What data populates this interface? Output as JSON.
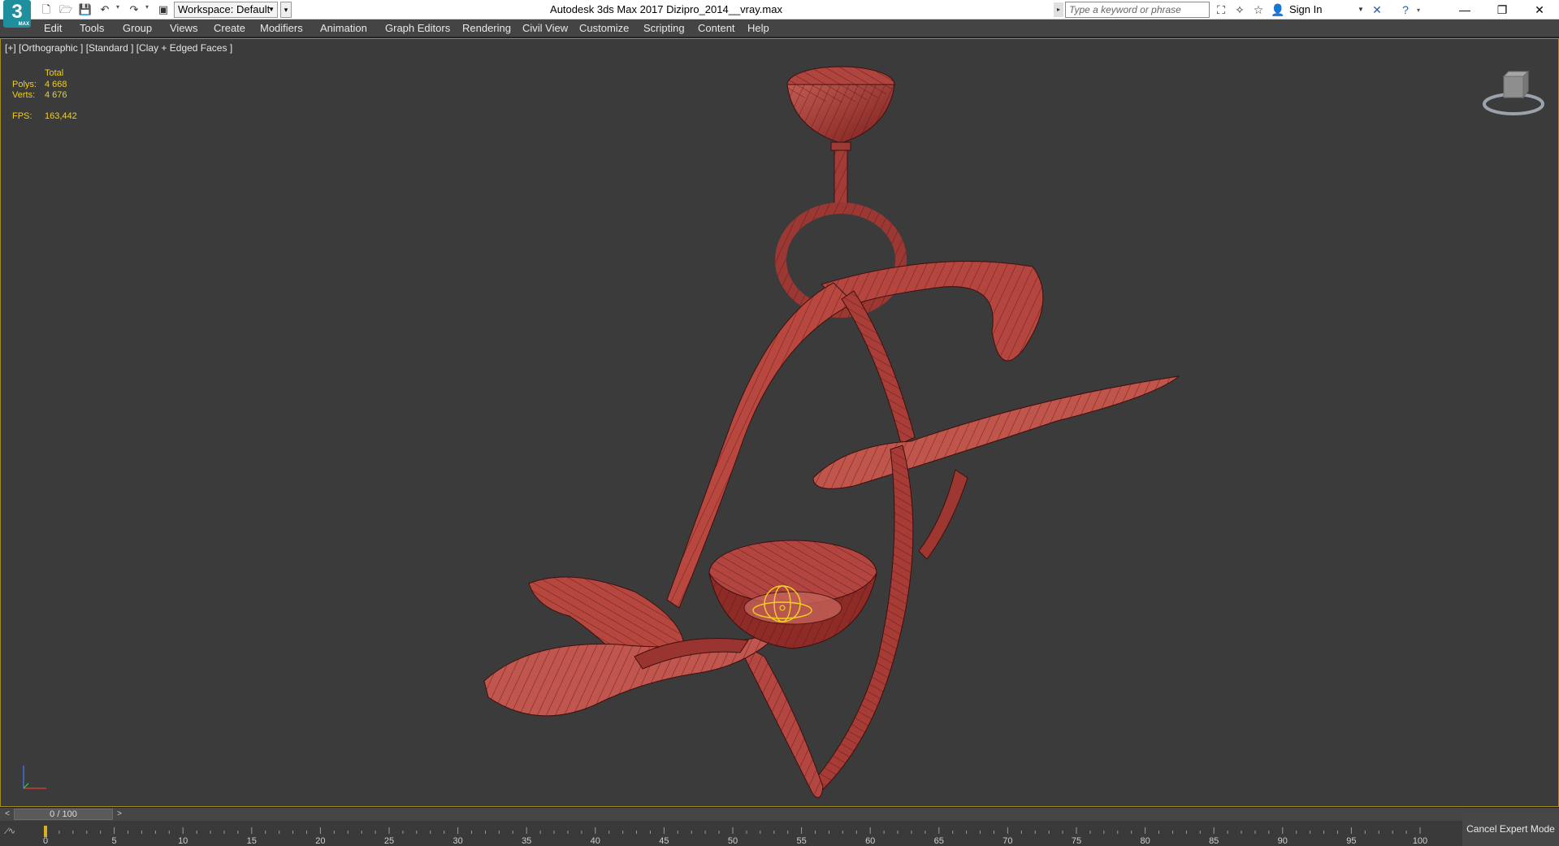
{
  "app": {
    "logo_text": "3",
    "logo_sub": "MAX",
    "window_title": "Autodesk 3ds Max 2017    Dizipro_2014__vray.max"
  },
  "quick_access": {
    "workspace_label": "Workspace: Default"
  },
  "search": {
    "placeholder": "Type a keyword or phrase"
  },
  "account": {
    "sign_in": "Sign In"
  },
  "menu": {
    "items": [
      "Edit",
      "Tools",
      "Group",
      "Views",
      "Create",
      "Modifiers",
      "Animation",
      "Graph Editors",
      "Rendering",
      "Civil View",
      "Customize",
      "Scripting",
      "Content",
      "Help"
    ]
  },
  "viewport": {
    "label": "[+] [Orthographic ] [Standard ] [Clay + Edged Faces ]",
    "stats": {
      "header": "Total",
      "polys_label": "Polys:",
      "polys_value": "4 668",
      "verts_label": "Verts:",
      "verts_value": "4 676",
      "fps_label": "FPS:",
      "fps_value": "163,442"
    },
    "model_color": "#a5302c",
    "selection_color": "#f0d020"
  },
  "timeline": {
    "frame_display": "0 / 100",
    "prev": "<",
    "next": ">",
    "ticks": [
      "0",
      "5",
      "10",
      "15",
      "20",
      "25",
      "30",
      "35",
      "40",
      "45",
      "50",
      "55",
      "60",
      "65",
      "70",
      "75",
      "80",
      "85",
      "90",
      "95",
      "100"
    ]
  },
  "status": {
    "cancel_expert_mode": "Cancel Expert Mode"
  }
}
